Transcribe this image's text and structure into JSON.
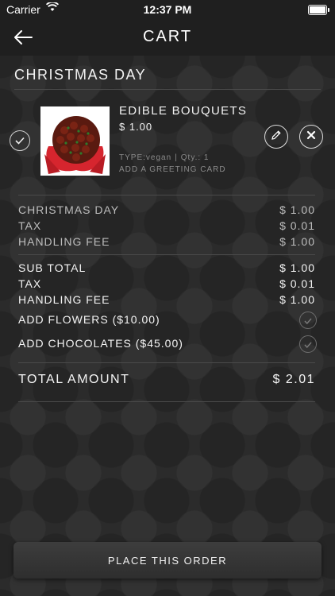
{
  "status_bar": {
    "carrier": "Carrier",
    "time": "12:37 PM"
  },
  "header": {
    "title": "CART"
  },
  "section": {
    "title": "CHRISTMAS DAY"
  },
  "item": {
    "name": "EDIBLE BOUQUETS",
    "price": "$ 1.00",
    "type": "TYPE:vegan",
    "separator": "|",
    "qty": "Qty.: 1",
    "greeting_link": "ADD A GREETING CARD"
  },
  "item_summary": [
    {
      "label": "CHRISTMAS DAY",
      "value": "$ 1.00"
    },
    {
      "label": "TAX",
      "value": "$ 0.01"
    },
    {
      "label": "HANDLING FEE",
      "value": "$ 1.00"
    }
  ],
  "order_summary": [
    {
      "label": "SUB TOTAL",
      "value": "$ 1.00"
    },
    {
      "label": "TAX",
      "value": "$ 0.01"
    },
    {
      "label": "HANDLING FEE",
      "value": "$ 1.00"
    }
  ],
  "addons": [
    {
      "label": "ADD FLOWERS ($10.00)"
    },
    {
      "label": "ADD CHOCOLATES ($45.00)"
    }
  ],
  "total": {
    "label": "TOTAL AMOUNT",
    "value": "$ 2.01"
  },
  "place_order": {
    "label": "PLACE THIS ORDER"
  },
  "icons": {
    "back": "back-arrow-icon",
    "edit": "pencil-icon",
    "remove": "close-icon",
    "select": "checkmark-icon"
  }
}
